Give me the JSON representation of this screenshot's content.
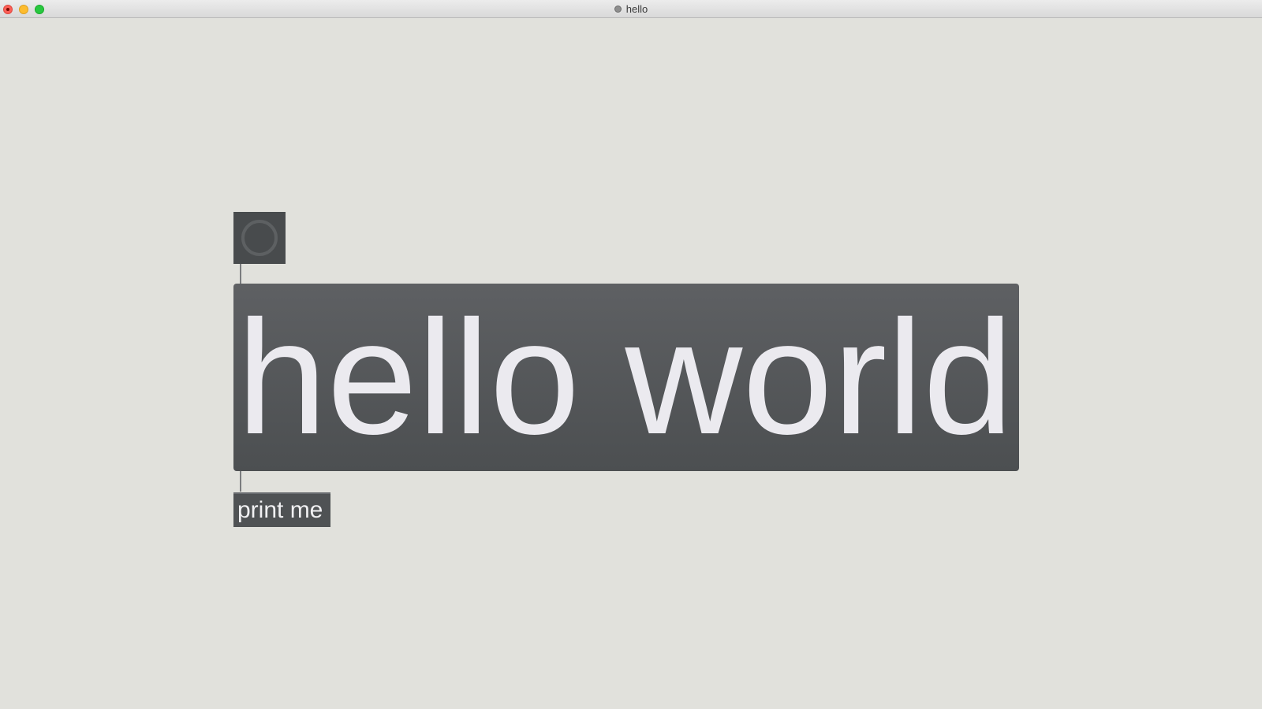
{
  "window": {
    "title": "hello"
  },
  "patcher": {
    "bang": {
      "icon": "bang-circle-icon"
    },
    "big_message": {
      "text": "hello world"
    },
    "small_message": {
      "text": "print me"
    }
  },
  "colors": {
    "canvas_bg": "#e1e1dc",
    "object_bg": "#4f5254",
    "object_text": "#ebeaef",
    "close": "#fc5f57",
    "minimize": "#fdbc2e",
    "maximize": "#28c840"
  }
}
